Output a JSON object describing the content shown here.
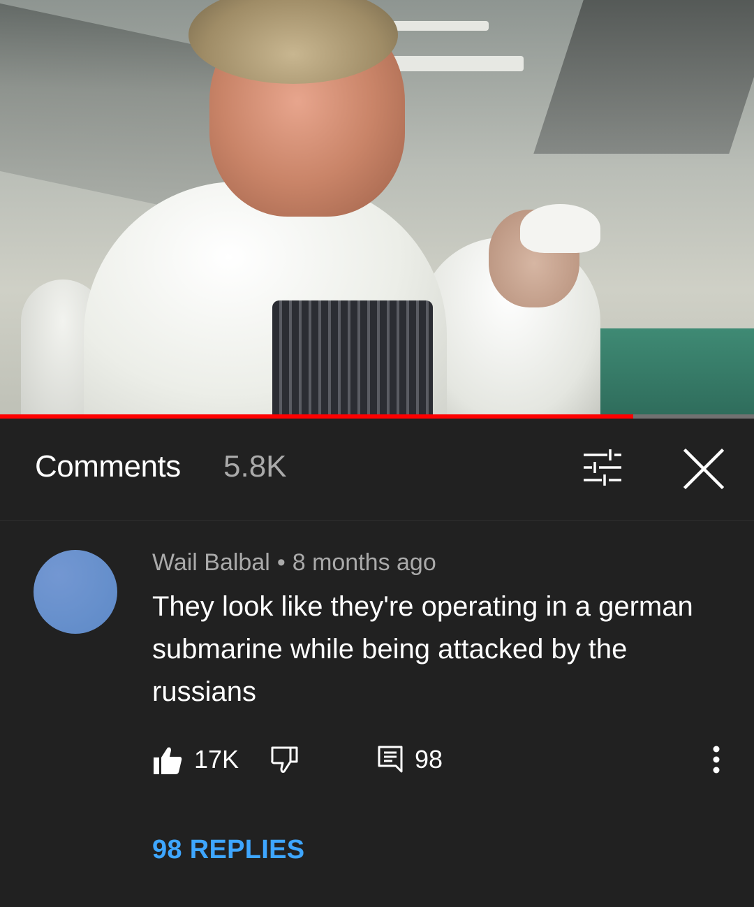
{
  "video": {
    "progress_percent": 84
  },
  "comments_header": {
    "title": "Comments",
    "count": "5.8K",
    "filter_icon": "sort-filter-icon",
    "close_icon": "close-icon"
  },
  "comment": {
    "author": "Wail Balbal",
    "separator": "•",
    "time": "8 months ago",
    "text": "They look like they're operating in a german submarine while being attacked by the russians",
    "like_count": "17K",
    "reply_count": "98",
    "replies_label": "98 REPLIES",
    "avatar_color": "#6790cc"
  },
  "colors": {
    "background": "#212121",
    "accent_link": "#3ea6ff",
    "progress": "#ff0000"
  }
}
